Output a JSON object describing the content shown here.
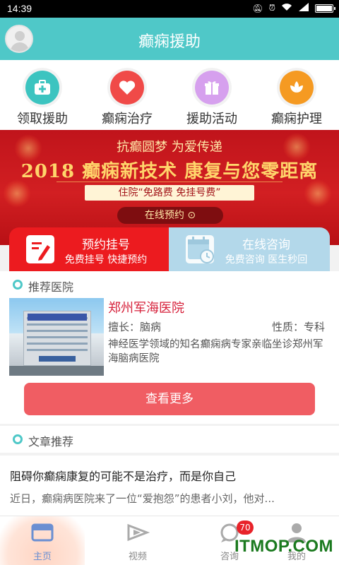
{
  "status_bar": {
    "time": "14:39",
    "signal": "signal-icon",
    "wifi": "wifi-icon",
    "alarm": "alarm-icon",
    "mute": "mute-icon",
    "battery": "battery-icon"
  },
  "header": {
    "title": "癫痫援助",
    "avatar": "avatar-icon",
    "color": "#4fc8c8"
  },
  "quick_nav": [
    {
      "label": "领取援助",
      "icon": "medkit-icon",
      "color": "#3cc4c0"
    },
    {
      "label": "癫痫治疗",
      "icon": "heart-icon",
      "color": "#f04a48"
    },
    {
      "label": "援助活动",
      "icon": "gift-icon",
      "color": "#d6a0ee"
    },
    {
      "label": "癫痫护理",
      "icon": "flower-icon",
      "color": "#f59a22"
    }
  ],
  "banner": {
    "slogan": "抗癫圆梦 为爱传递",
    "headline": "2018 癫痫新技术 康复与您零距离",
    "free": "住院“免路费 免挂号费”",
    "button": "在线预约 ⊙"
  },
  "service_cards": [
    {
      "title": "预约挂号",
      "subtitle": "免费挂号 快捷预约",
      "icon": "edit-form-icon",
      "color": "#ec1b1f"
    },
    {
      "title": "在线咨询",
      "subtitle": "免费咨询 医生秒回",
      "icon": "calendar-clock-icon",
      "color": "#b3d8ea"
    }
  ],
  "recommend": {
    "section_title": "推荐医院",
    "hospital": {
      "name": "郑州军海医院",
      "specialty": "擅长：脑病",
      "nature": "性质：专科",
      "description": "神经医学领域的知名癫痫病专家亲临坐诊郑州军海脑病医院"
    },
    "more_button": "查看更多"
  },
  "articles": {
    "section_title": "文章推荐",
    "items": [
      {
        "title": "阻碍你癫痫康复的可能不是治疗，而是你自己",
        "summary": "近日，癫痫病医院来了一位“爱抱怨”的患者小刘，他对..."
      }
    ]
  },
  "tab_bar": [
    {
      "label": "主页",
      "icon": "home-icon",
      "active": true
    },
    {
      "label": "视频",
      "icon": "video-icon",
      "active": false
    },
    {
      "label": "咨询",
      "icon": "chat-icon",
      "badge": "70",
      "active": false
    },
    {
      "label": "我的",
      "icon": "user-icon",
      "active": false
    }
  ],
  "watermark": "ITMOP.COM"
}
